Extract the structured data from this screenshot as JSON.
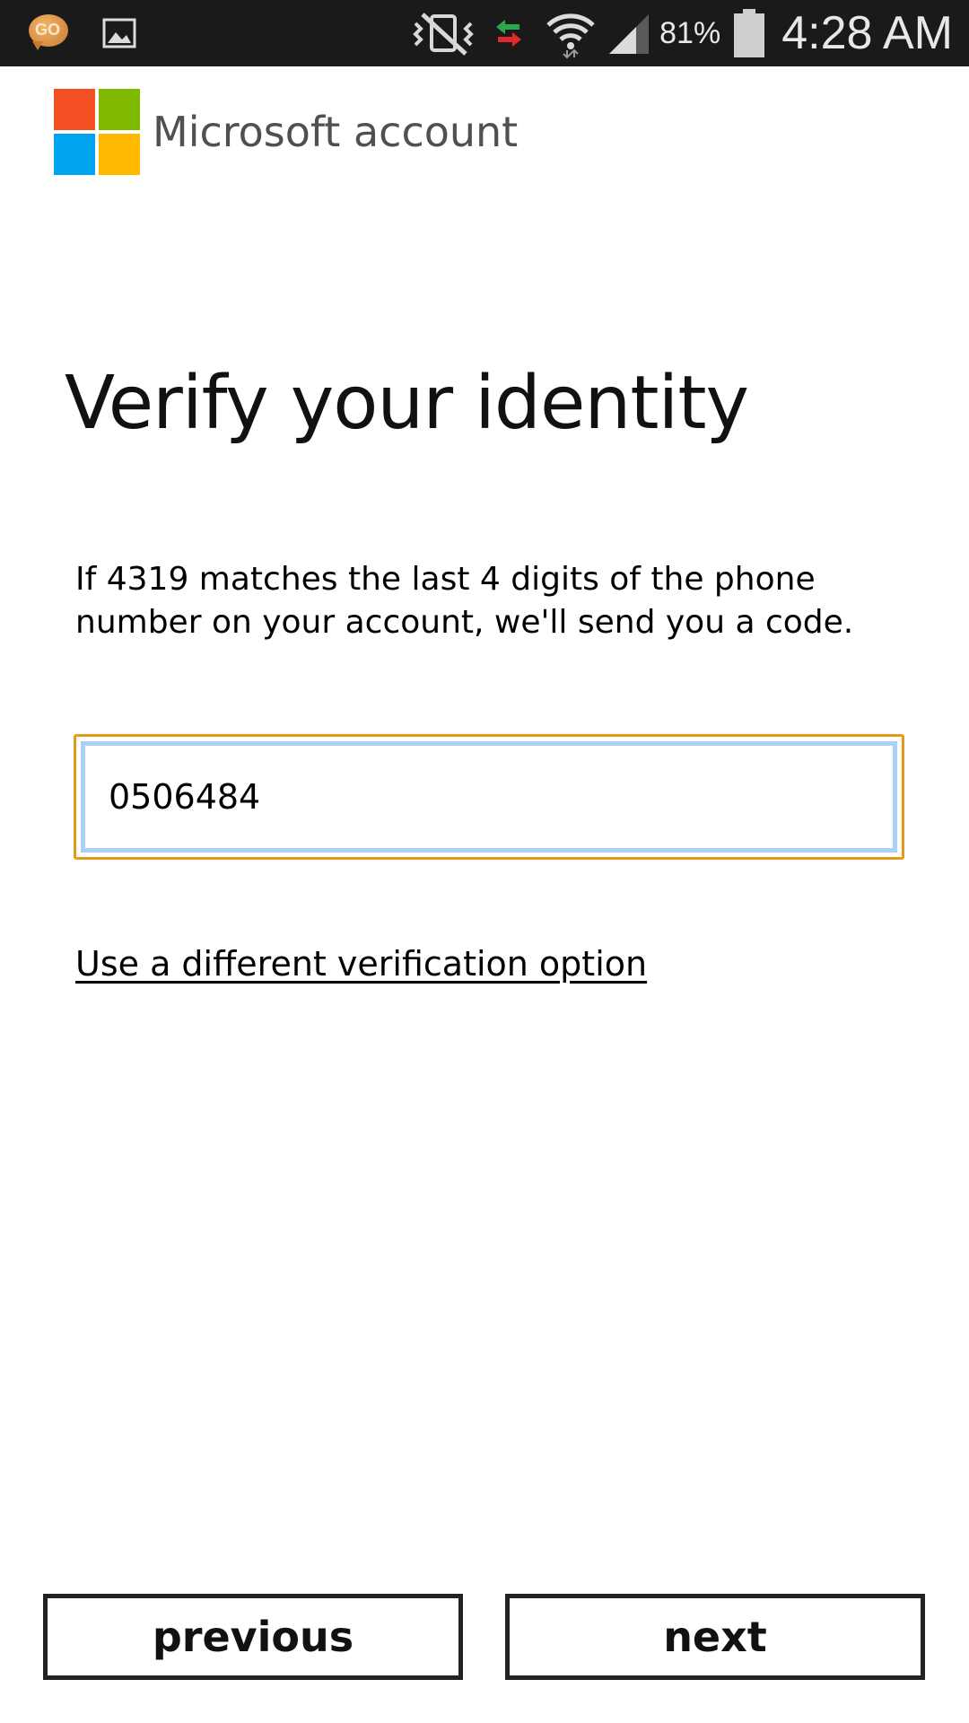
{
  "status_bar": {
    "left_icons": [
      "go-sms-icon",
      "gallery-icon"
    ],
    "right_icons": [
      "vibrate-mute-icon",
      "data-transfer-icon",
      "wifi-icon",
      "signal-icon",
      "battery-icon"
    ],
    "battery_percent": "81%",
    "time": "4:28 AM"
  },
  "header": {
    "brand": "Microsoft account",
    "logo_colors": [
      "#f25022",
      "#7fba00",
      "#00a4ef",
      "#ffb900"
    ]
  },
  "main": {
    "title": "Verify your identity",
    "instructions": "If 4319 matches the last 4 digits of the phone number on your account, we'll send you a code.",
    "phone_input": {
      "value": "0506484",
      "placeholder": ""
    },
    "alt_link": "Use a different verification option"
  },
  "footer": {
    "previous_label": "previous",
    "next_label": "next"
  },
  "colors": {
    "focus_outer": "#e59a1e",
    "focus_inner": "#a9d1f7",
    "status_bar_bg": "#1a1a1a"
  }
}
